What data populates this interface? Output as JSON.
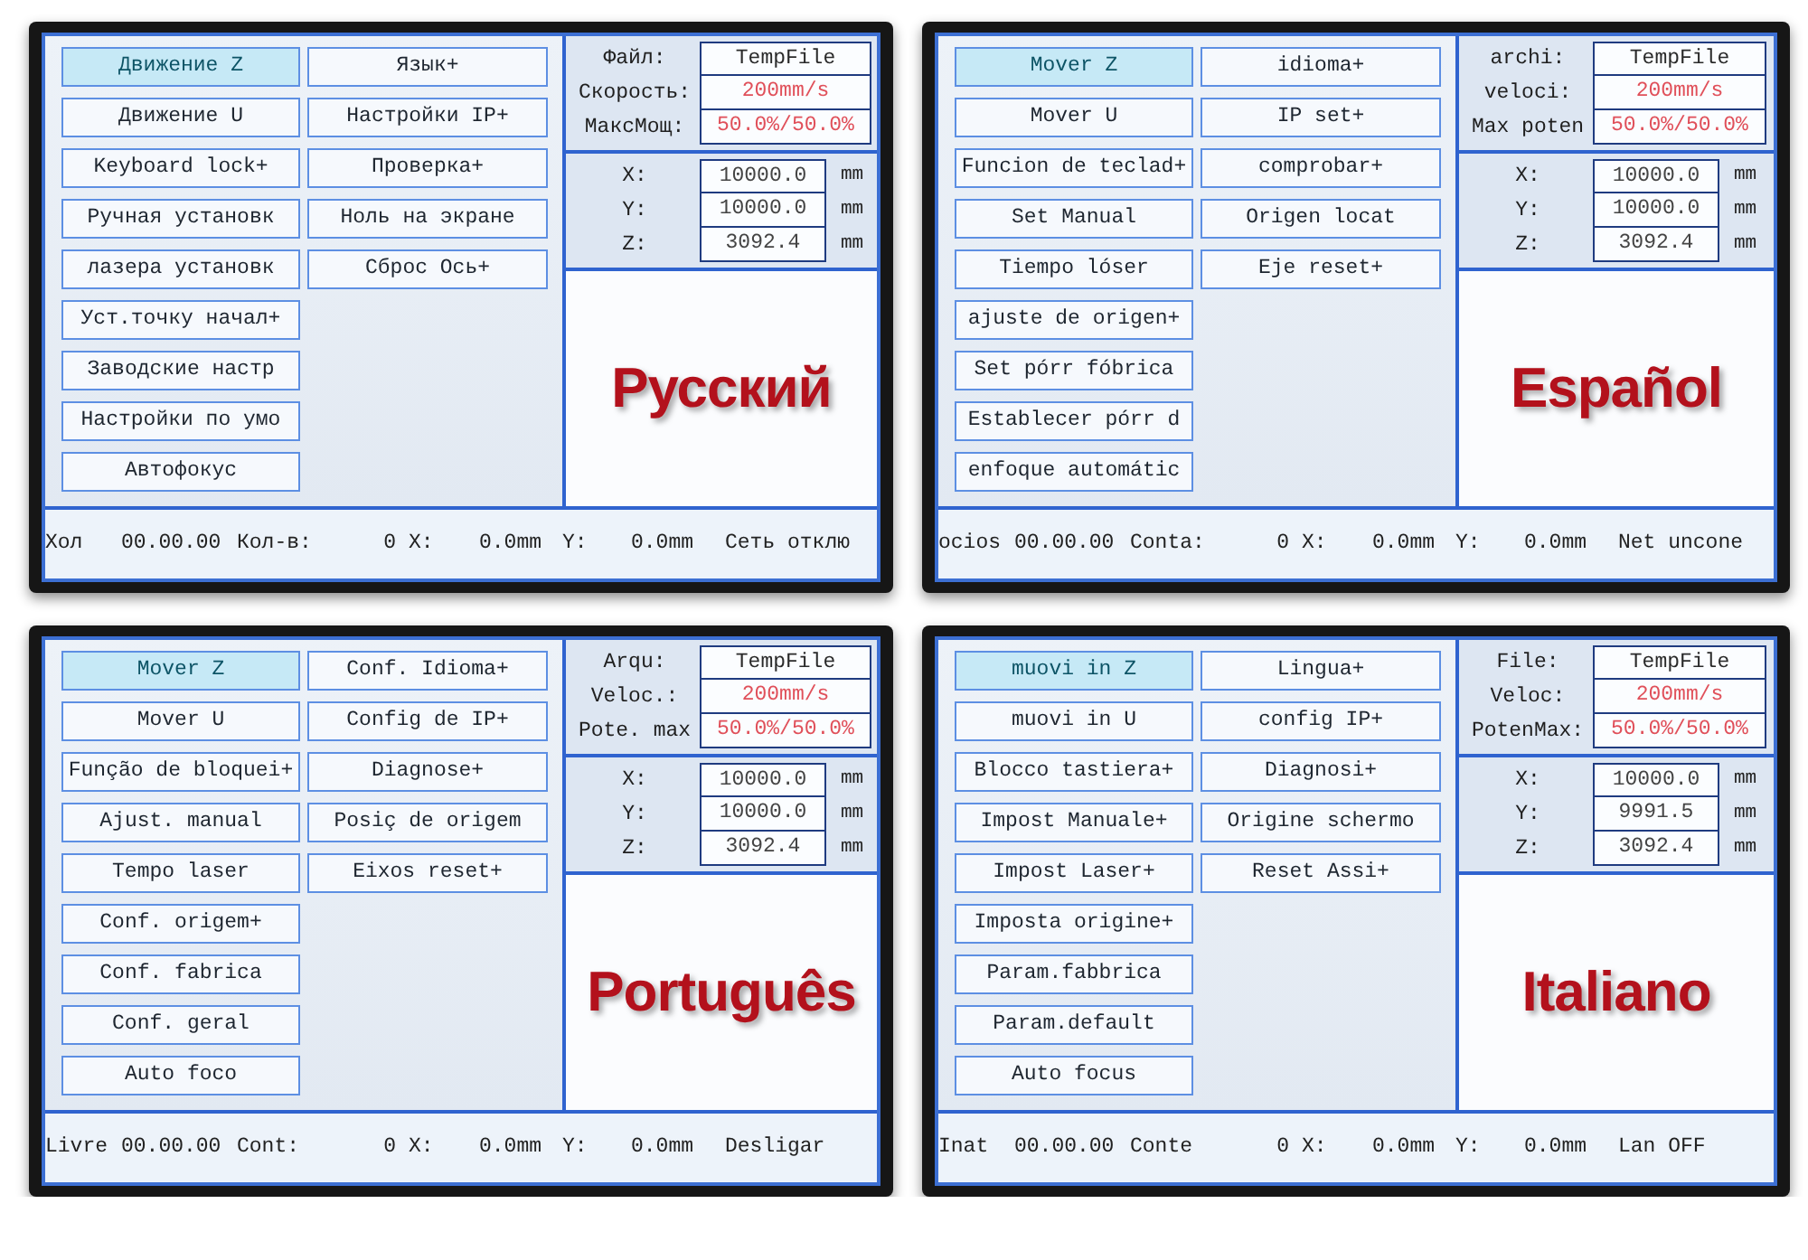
{
  "screens": [
    {
      "title": "Русский",
      "menu_left": [
        {
          "label": "Движение Z",
          "selected": true
        },
        {
          "label": "Движение U",
          "selected": false
        },
        {
          "label": "Keyboard lock+",
          "selected": false
        },
        {
          "label": "Ручная установк",
          "selected": false
        },
        {
          "label": "лазера установк",
          "selected": false
        },
        {
          "label": "Уст.точку начал+",
          "selected": false
        },
        {
          "label": "Заводские настр",
          "selected": false
        },
        {
          "label": "Настройки по умо",
          "selected": false
        },
        {
          "label": "Автофокус",
          "selected": false
        }
      ],
      "menu_right": [
        {
          "label": "Язык+",
          "selected": false
        },
        {
          "label": "Настройки IP+",
          "selected": false
        },
        {
          "label": "Проверка+",
          "selected": false
        },
        {
          "label": "Ноль на экране",
          "selected": false
        },
        {
          "label": "Сброс Ось+",
          "selected": false
        }
      ],
      "job": [
        {
          "kind": "file",
          "label": "Файл:",
          "value": "TempFile"
        },
        {
          "kind": "setting",
          "label": "Скорость:",
          "value": "200mm/s"
        },
        {
          "kind": "setting",
          "label": "МаксМощ:",
          "value": "50.0%/50.0%"
        }
      ],
      "coordinates": [
        {
          "axis": "X:",
          "value": "10000.0",
          "unit": "mm"
        },
        {
          "axis": "Y:",
          "value": "10000.0",
          "unit": "mm"
        },
        {
          "axis": "Z:",
          "value": "3092.4",
          "unit": "mm"
        }
      ],
      "status_bar": {
        "state": "Хол",
        "time": "00.00.00",
        "count_label": "Кол-в:",
        "count": "0",
        "x_label": "X:",
        "x": "0.0mm",
        "y_label": "Y:",
        "y": "0.0mm",
        "network": "Сеть отклю"
      }
    },
    {
      "title": "Español",
      "menu_left": [
        {
          "label": "Mover Z",
          "selected": true
        },
        {
          "label": "Mover U",
          "selected": false
        },
        {
          "label": "Funcion de teclad+",
          "selected": false
        },
        {
          "label": "Set Manual",
          "selected": false
        },
        {
          "label": "Tiempo lóser",
          "selected": false
        },
        {
          "label": "ajuste de origen+",
          "selected": false
        },
        {
          "label": "Set pórr fóbrica",
          "selected": false
        },
        {
          "label": "Establecer pórr d",
          "selected": false
        },
        {
          "label": "enfoque automátic",
          "selected": false
        }
      ],
      "menu_right": [
        {
          "label": "idioma+",
          "selected": false
        },
        {
          "label": "IP set+",
          "selected": false
        },
        {
          "label": "comprobar+",
          "selected": false
        },
        {
          "label": "Origen locat",
          "selected": false
        },
        {
          "label": "Eje reset+",
          "selected": false
        }
      ],
      "job": [
        {
          "kind": "file",
          "label": "archi:",
          "value": "TempFile"
        },
        {
          "kind": "setting",
          "label": "veloci:",
          "value": "200mm/s"
        },
        {
          "kind": "setting",
          "label": "Max poten",
          "value": "50.0%/50.0%"
        }
      ],
      "coordinates": [
        {
          "axis": "X:",
          "value": "10000.0",
          "unit": "mm"
        },
        {
          "axis": "Y:",
          "value": "10000.0",
          "unit": "mm"
        },
        {
          "axis": "Z:",
          "value": "3092.4",
          "unit": "mm"
        }
      ],
      "status_bar": {
        "state": "ocios",
        "time": "00.00.00",
        "count_label": "Conta:",
        "count": "0",
        "x_label": "X:",
        "x": "0.0mm",
        "y_label": "Y:",
        "y": "0.0mm",
        "network": "Net uncone"
      }
    },
    {
      "title": "Português",
      "menu_left": [
        {
          "label": "Mover Z",
          "selected": true
        },
        {
          "label": "Mover U",
          "selected": false
        },
        {
          "label": "Função de bloquei+",
          "selected": false
        },
        {
          "label": "Ajust. manual",
          "selected": false
        },
        {
          "label": "Tempo laser",
          "selected": false
        },
        {
          "label": "Conf. origem+",
          "selected": false
        },
        {
          "label": "Conf. fabrica",
          "selected": false
        },
        {
          "label": "Conf. geral",
          "selected": false
        },
        {
          "label": "Auto foco",
          "selected": false
        }
      ],
      "menu_right": [
        {
          "label": "Conf. Idioma+",
          "selected": false
        },
        {
          "label": "Config de IP+",
          "selected": false
        },
        {
          "label": "Diagnose+",
          "selected": false
        },
        {
          "label": "Posiç de origem",
          "selected": false
        },
        {
          "label": "Eixos reset+",
          "selected": false
        }
      ],
      "job": [
        {
          "kind": "file",
          "label": "Arqu:",
          "value": "TempFile"
        },
        {
          "kind": "setting",
          "label": "Veloc.:",
          "value": "200mm/s"
        },
        {
          "kind": "setting",
          "label": "Pote. max",
          "value": "50.0%/50.0%"
        }
      ],
      "coordinates": [
        {
          "axis": "X:",
          "value": "10000.0",
          "unit": "mm"
        },
        {
          "axis": "Y:",
          "value": "10000.0",
          "unit": "mm"
        },
        {
          "axis": "Z:",
          "value": "3092.4",
          "unit": "mm"
        }
      ],
      "status_bar": {
        "state": "Livre",
        "time": "00.00.00",
        "count_label": "Cont:",
        "count": "0",
        "x_label": "X:",
        "x": "0.0mm",
        "y_label": "Y:",
        "y": "0.0mm",
        "network": "Desligar"
      }
    },
    {
      "title": "Italiano",
      "menu_left": [
        {
          "label": "muovi in Z",
          "selected": true
        },
        {
          "label": "muovi in U",
          "selected": false
        },
        {
          "label": "Blocco tastiera+",
          "selected": false
        },
        {
          "label": "Impost Manuale+",
          "selected": false
        },
        {
          "label": "Impost Laser+",
          "selected": false
        },
        {
          "label": "Imposta origine+",
          "selected": false
        },
        {
          "label": "Param.fabbrica",
          "selected": false
        },
        {
          "label": "Param.default",
          "selected": false
        },
        {
          "label": "Auto focus",
          "selected": false
        }
      ],
      "menu_right": [
        {
          "label": "Lingua+",
          "selected": false
        },
        {
          "label": "config IP+",
          "selected": false
        },
        {
          "label": "Diagnosi+",
          "selected": false
        },
        {
          "label": "Origine schermo",
          "selected": false
        },
        {
          "label": "Reset Assi+",
          "selected": false
        }
      ],
      "job": [
        {
          "kind": "file",
          "label": "File:",
          "value": "TempFile"
        },
        {
          "kind": "setting",
          "label": "Veloc:",
          "value": "200mm/s"
        },
        {
          "kind": "setting",
          "label": "PotenMax:",
          "value": "50.0%/50.0%"
        }
      ],
      "coordinates": [
        {
          "axis": "X:",
          "value": "10000.0",
          "unit": "mm"
        },
        {
          "axis": "Y:",
          "value": "9991.5",
          "unit": "mm"
        },
        {
          "axis": "Z:",
          "value": "3092.4",
          "unit": "mm"
        }
      ],
      "status_bar": {
        "state": "Inat",
        "time": "00.00.00",
        "count_label": "Conte",
        "count": "0",
        "x_label": "X:",
        "x": "0.0mm",
        "y_label": "Y:",
        "y": "0.0mm",
        "network": "Lan OFF"
      }
    }
  ]
}
